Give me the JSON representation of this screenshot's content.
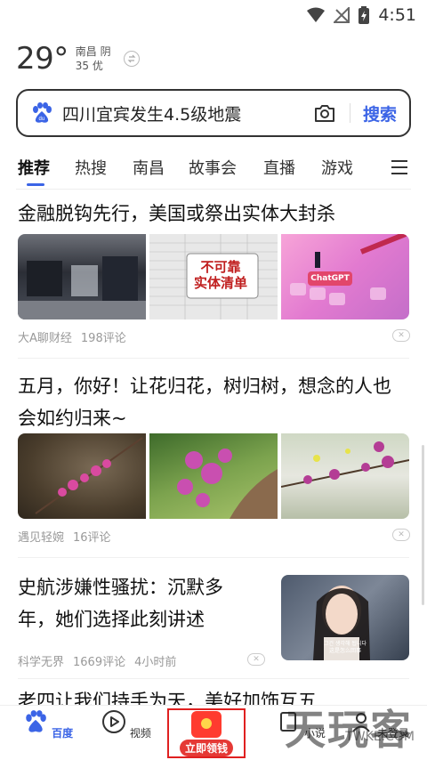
{
  "status_bar": {
    "time": "4:51",
    "wifi_icon": "wifi-icon",
    "signal_icon": "no-signal-icon",
    "battery_icon": "battery-charging-icon"
  },
  "weather": {
    "temperature": "29°",
    "city": "南昌",
    "condition": "阴",
    "aqi": "35 优"
  },
  "search": {
    "query": "四川宜宾发生4.5级地震",
    "button_label": "搜索"
  },
  "tabs": [
    "推荐",
    "热搜",
    "南昌",
    "故事会",
    "直播",
    "游戏"
  ],
  "feed": [
    {
      "title": "金融脱钩先行，美国或祭出实体大封杀",
      "source": "大A聊财经",
      "comments": "198评论",
      "overlay_text_1": "不可靠",
      "overlay_text_2": "实体清单",
      "chatgpt_label": "ChatGPT"
    },
    {
      "title": "五月，你好！让花归花，树归树，想念的人也会如约归来~",
      "source": "遇见轻婉",
      "comments": "16评论"
    },
    {
      "title": "史航涉嫌性骚扰：沉默多年，她们选择此刻讲述",
      "source": "科学无界",
      "comments": "1669评论",
      "time": "4小时前",
      "subtitle_1": "그건 생각해 됩니다",
      "subtitle_2": "这是怎么回事"
    },
    {
      "title": "老四让我们持手为天，美好加饰互五"
    }
  ],
  "bottom_nav": [
    {
      "label": "百度",
      "icon": "baidu-paw-icon"
    },
    {
      "label": "视频",
      "icon": "video-play-icon"
    },
    {
      "label": "立即领钱",
      "icon": "red-packet-icon"
    },
    {
      "label": "小说",
      "icon": "book-icon"
    },
    {
      "label": "未登录",
      "icon": "user-icon"
    }
  ],
  "watermark": {
    "main": "天玩客",
    "sub": "TWKE.COM"
  },
  "colors": {
    "accent": "#3b64e6",
    "highlight": "#e02020",
    "red_packet": "#ff3b2f"
  }
}
